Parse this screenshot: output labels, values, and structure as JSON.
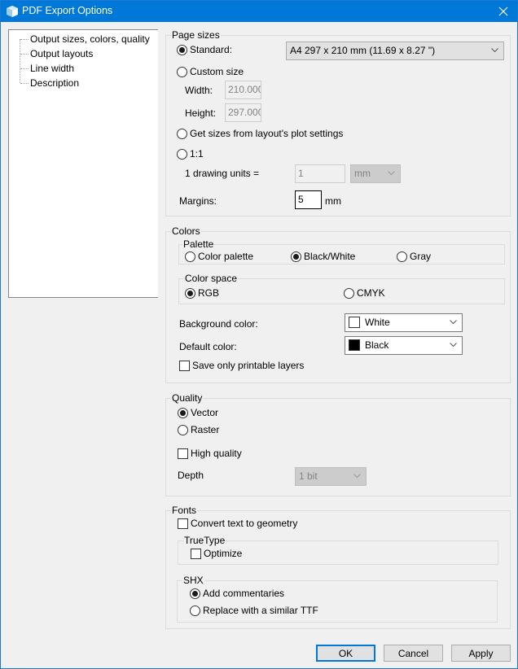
{
  "window": {
    "title": "PDF Export Options",
    "title_bar_color": "#0078d7"
  },
  "tree": {
    "items": [
      {
        "label": "Output sizes, colors, quality",
        "selected": true
      },
      {
        "label": "Output layouts"
      },
      {
        "label": "Line width"
      },
      {
        "label": "Description"
      }
    ]
  },
  "page_sizes": {
    "group_label": "Page sizes",
    "standard_label": "Standard:",
    "standard_selected": true,
    "standard_value": "A4 297 x 210 mm (11.69 x 8.27 \")",
    "custom_label": "Custom size",
    "width_label": "Width:",
    "width_value": "210.000",
    "height_label": "Height:",
    "height_value": "297.000",
    "from_layout_label": "Get sizes from layout's plot settings",
    "one_to_one_label": "1:1",
    "drawing_units_label": "1 drawing units =",
    "drawing_units_value": "1",
    "drawing_units_unit": "mm",
    "margins_label": "Margins:",
    "margins_value": "5",
    "margins_unit": "mm"
  },
  "colors": {
    "group_label": "Colors",
    "palette": {
      "group_label": "Palette",
      "options": [
        "Color palette",
        "Black/White",
        "Gray"
      ],
      "selected": "Black/White"
    },
    "color_space": {
      "group_label": "Color space",
      "options": [
        "RGB",
        "CMYK"
      ],
      "selected": "RGB"
    },
    "background_label": "Background color:",
    "background_value": "White",
    "background_swatch": "#ffffff",
    "default_label": "Default color:",
    "default_value": "Black",
    "default_swatch": "#000000",
    "printable_layers_label": "Save only printable layers",
    "printable_layers_checked": false
  },
  "quality": {
    "group_label": "Quality",
    "options": [
      "Vector",
      "Raster"
    ],
    "selected": "Vector",
    "high_quality_label": "High quality",
    "high_quality_checked": false,
    "depth_label": "Depth",
    "depth_value": "1 bit"
  },
  "fonts": {
    "group_label": "Fonts",
    "convert_label": "Convert text to geometry",
    "convert_checked": false,
    "truetype": {
      "group_label": "TrueType",
      "optimize_label": "Optimize",
      "optimize_checked": false
    },
    "shx": {
      "group_label": "SHX",
      "options": [
        "Add commentaries",
        "Replace with a similar TTF"
      ],
      "selected": "Add commentaries"
    }
  },
  "buttons": {
    "ok": "OK",
    "cancel": "Cancel",
    "apply": "Apply"
  }
}
